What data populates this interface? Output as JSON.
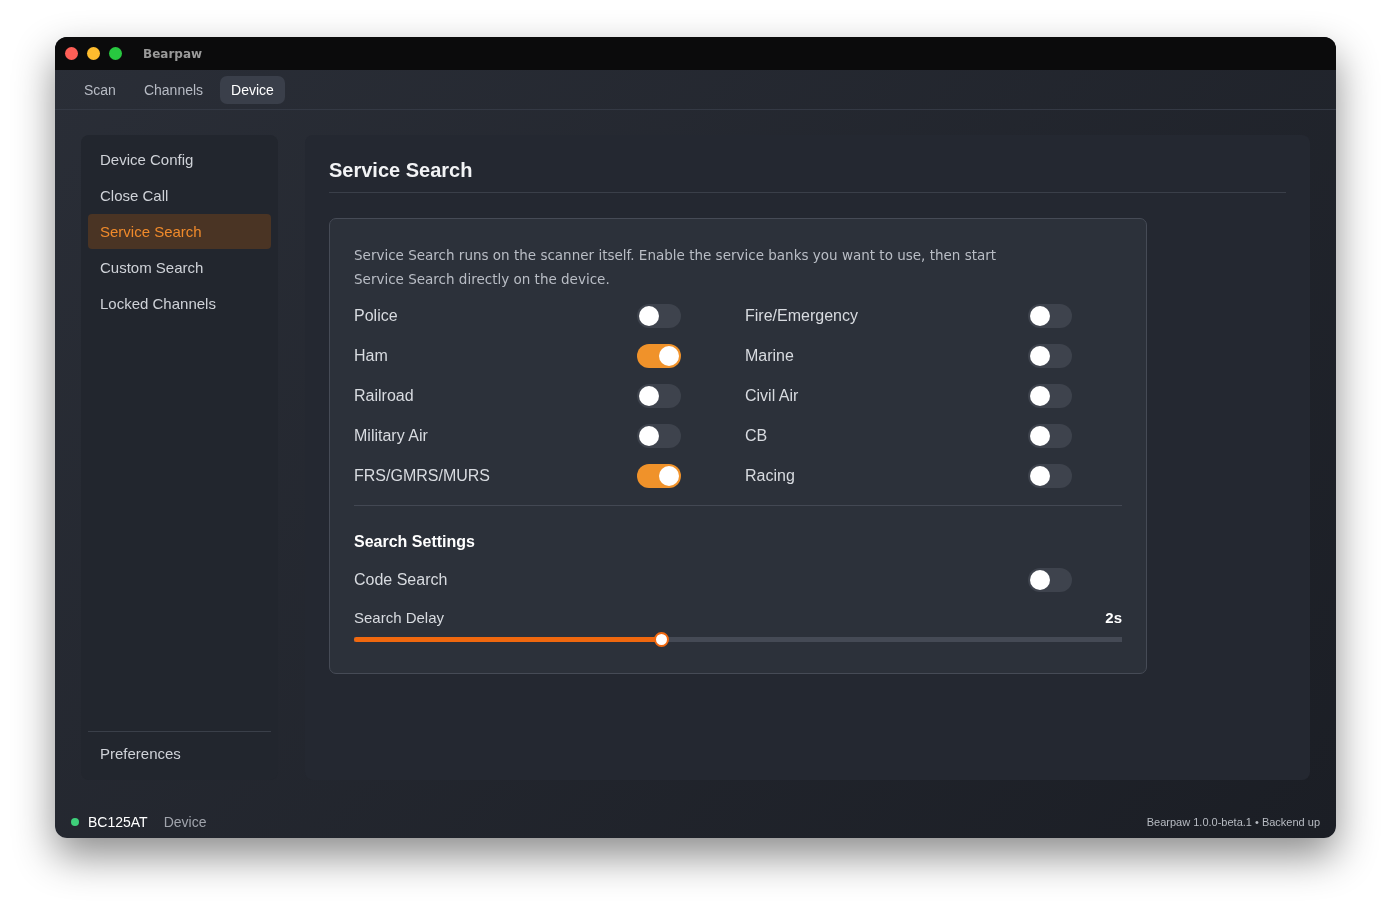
{
  "window": {
    "title": "Bearpaw"
  },
  "tabs": [
    {
      "label": "Scan",
      "selected": false
    },
    {
      "label": "Channels",
      "selected": false
    },
    {
      "label": "Device",
      "selected": true
    }
  ],
  "sidebar": {
    "items": [
      {
        "label": "Device Config",
        "selected": false
      },
      {
        "label": "Close Call",
        "selected": false
      },
      {
        "label": "Service Search",
        "selected": true
      },
      {
        "label": "Custom Search",
        "selected": false
      },
      {
        "label": "Locked Channels",
        "selected": false
      }
    ],
    "footer_item": {
      "label": "Preferences"
    }
  },
  "panel": {
    "title": "Service Search",
    "description": "Service Search runs on the scanner itself. Enable the service banks you want to use, then start Service Search directly on the device.",
    "banks": [
      {
        "label": "Police",
        "on": false
      },
      {
        "label": "Fire/Emergency",
        "on": false
      },
      {
        "label": "Ham",
        "on": true
      },
      {
        "label": "Marine",
        "on": false
      },
      {
        "label": "Railroad",
        "on": false
      },
      {
        "label": "Civil Air",
        "on": false
      },
      {
        "label": "Military Air",
        "on": false
      },
      {
        "label": "CB",
        "on": false
      },
      {
        "label": "FRS/GMRS/MURS",
        "on": true
      },
      {
        "label": "Racing",
        "on": false
      }
    ],
    "settings": {
      "title": "Search Settings",
      "rows": [
        {
          "kind": "toggle",
          "label": "Code Search",
          "on": false
        },
        {
          "kind": "slider",
          "label": "Search Delay",
          "reading": "2s",
          "level": 0.4
        }
      ]
    }
  },
  "status_bar": {
    "device": "BC125AT",
    "connected": true,
    "section": "Device",
    "version": "Bearpaw 1.0.0-beta.1 • Backend up"
  }
}
